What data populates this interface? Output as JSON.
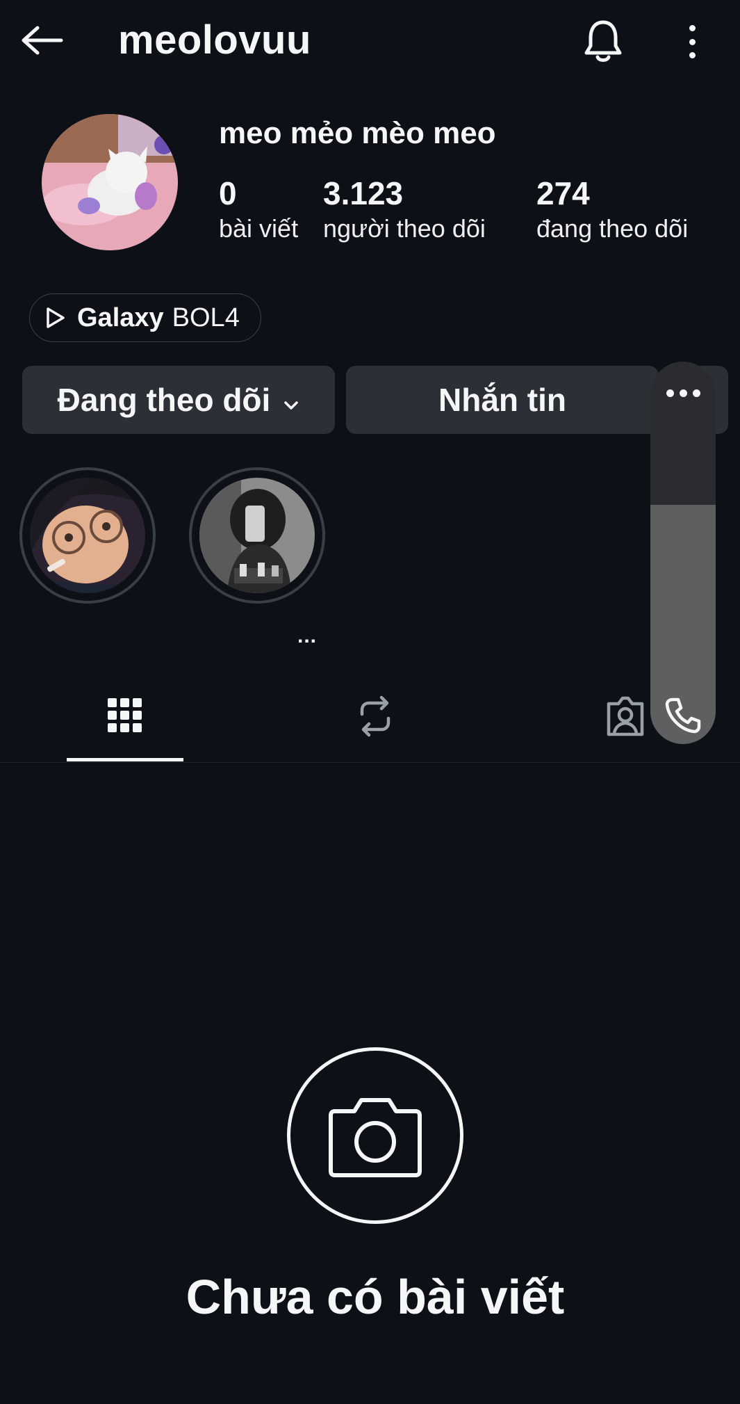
{
  "header": {
    "username": "meolovuu"
  },
  "profile": {
    "display_name": "meo mẻo mèo meo",
    "stats": [
      {
        "value": "0",
        "label": "bài viết"
      },
      {
        "value": "3.123",
        "label": "người theo dõi"
      },
      {
        "value": "274",
        "label": "đang theo dõi"
      }
    ],
    "music": {
      "song": "Galaxy",
      "artist": "BOL4"
    }
  },
  "buttons": {
    "following": "Đang theo dõi",
    "message": "Nhắn tin"
  },
  "highlights_more": "...",
  "empty_state": {
    "text": "Chưa có bài viết"
  },
  "icons": {
    "back": "arrow-left-icon",
    "bell": "bell-icon",
    "kebab": "more-vertical-icon",
    "grid": "grid-icon",
    "reels": "repost-icon",
    "tagged": "tagged-person-icon",
    "camera": "camera-icon",
    "phone": "phone-icon"
  },
  "colors": {
    "background": "#0d1117",
    "button": "#2c3036",
    "text": "#f5f6f7"
  }
}
